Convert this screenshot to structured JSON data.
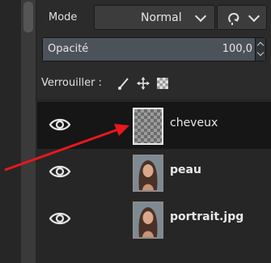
{
  "mode": {
    "label": "Mode",
    "value": "Normal"
  },
  "opacity": {
    "label": "Opacité",
    "value": "100,0",
    "fraction": 1.0
  },
  "lock": {
    "label": "Verrouiller :",
    "icons": [
      "paintbrush-lock-icon",
      "move-lock-icon",
      "alpha-lock-icon"
    ]
  },
  "layers": [
    {
      "name": "cheveux",
      "thumbnail": "transparent",
      "selected": true
    },
    {
      "name": "peau",
      "thumbnail": "portrait",
      "selected": false
    },
    {
      "name": "portrait.jpg",
      "thumbnail": "portrait",
      "selected": false
    }
  ],
  "colors": {
    "annotation_arrow": "#e8181c",
    "panel_bg": "#2b2b2b",
    "selected_row": "#161616"
  }
}
